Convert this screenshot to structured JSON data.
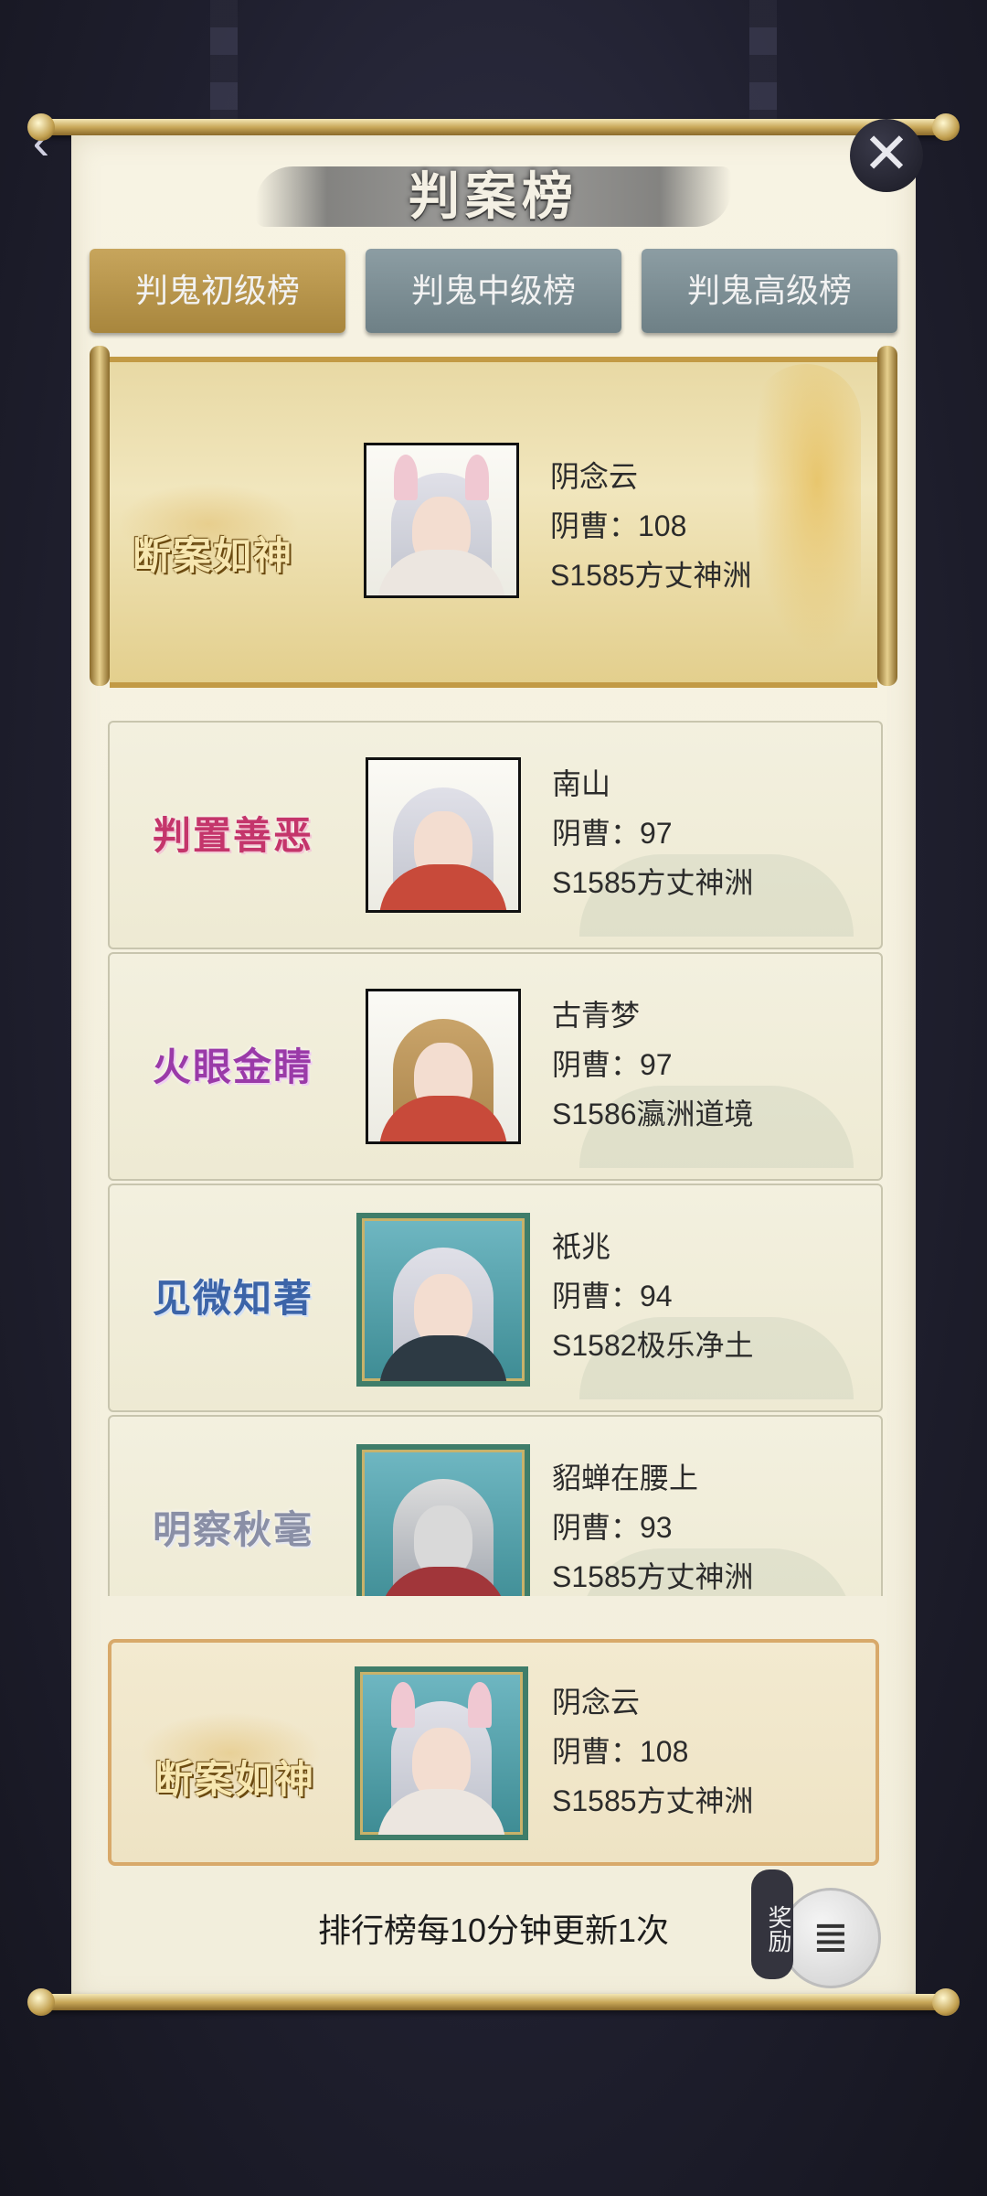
{
  "header": {
    "title": "判案榜",
    "close_icon": "close-icon",
    "back_icon": "back-arrow-icon"
  },
  "tabs": [
    {
      "label": "判鬼初级榜",
      "active": true
    },
    {
      "label": "判鬼中级榜",
      "active": false
    },
    {
      "label": "判鬼高级榜",
      "active": false
    }
  ],
  "top_entry": {
    "title": "断案如神",
    "name": "阴念云",
    "score": "阴曹：108",
    "server": "S1585方丈神洲"
  },
  "entries": [
    {
      "title": "判置善恶",
      "name": "南山",
      "score": "阴曹：97",
      "server": "S1585方丈神洲"
    },
    {
      "title": "火眼金睛",
      "name": "古青梦",
      "score": "阴曹：97",
      "server": "S1586瀛洲道境"
    },
    {
      "title": "见微知著",
      "name": "祇兆",
      "score": "阴曹：94",
      "server": "S1582极乐净土"
    },
    {
      "title": "明察秋毫",
      "name": "貂蝉在腰上",
      "score": "阴曹：93",
      "server": "S1585方丈神洲"
    }
  ],
  "my_entry": {
    "title": "断案如神",
    "name": "阴念云",
    "score": "阴曹：108",
    "server": "S1585方丈神洲"
  },
  "footer": {
    "note": "排行榜每10分钟更新1次",
    "reward_label": "奖励",
    "reward_icon": "reward-chest-icon"
  },
  "colors": {
    "active_tab": "#b8964b",
    "inactive_tab": "#7d8f95",
    "panel": "#f4f0e0",
    "my_entry_border": "#d8a96a"
  }
}
